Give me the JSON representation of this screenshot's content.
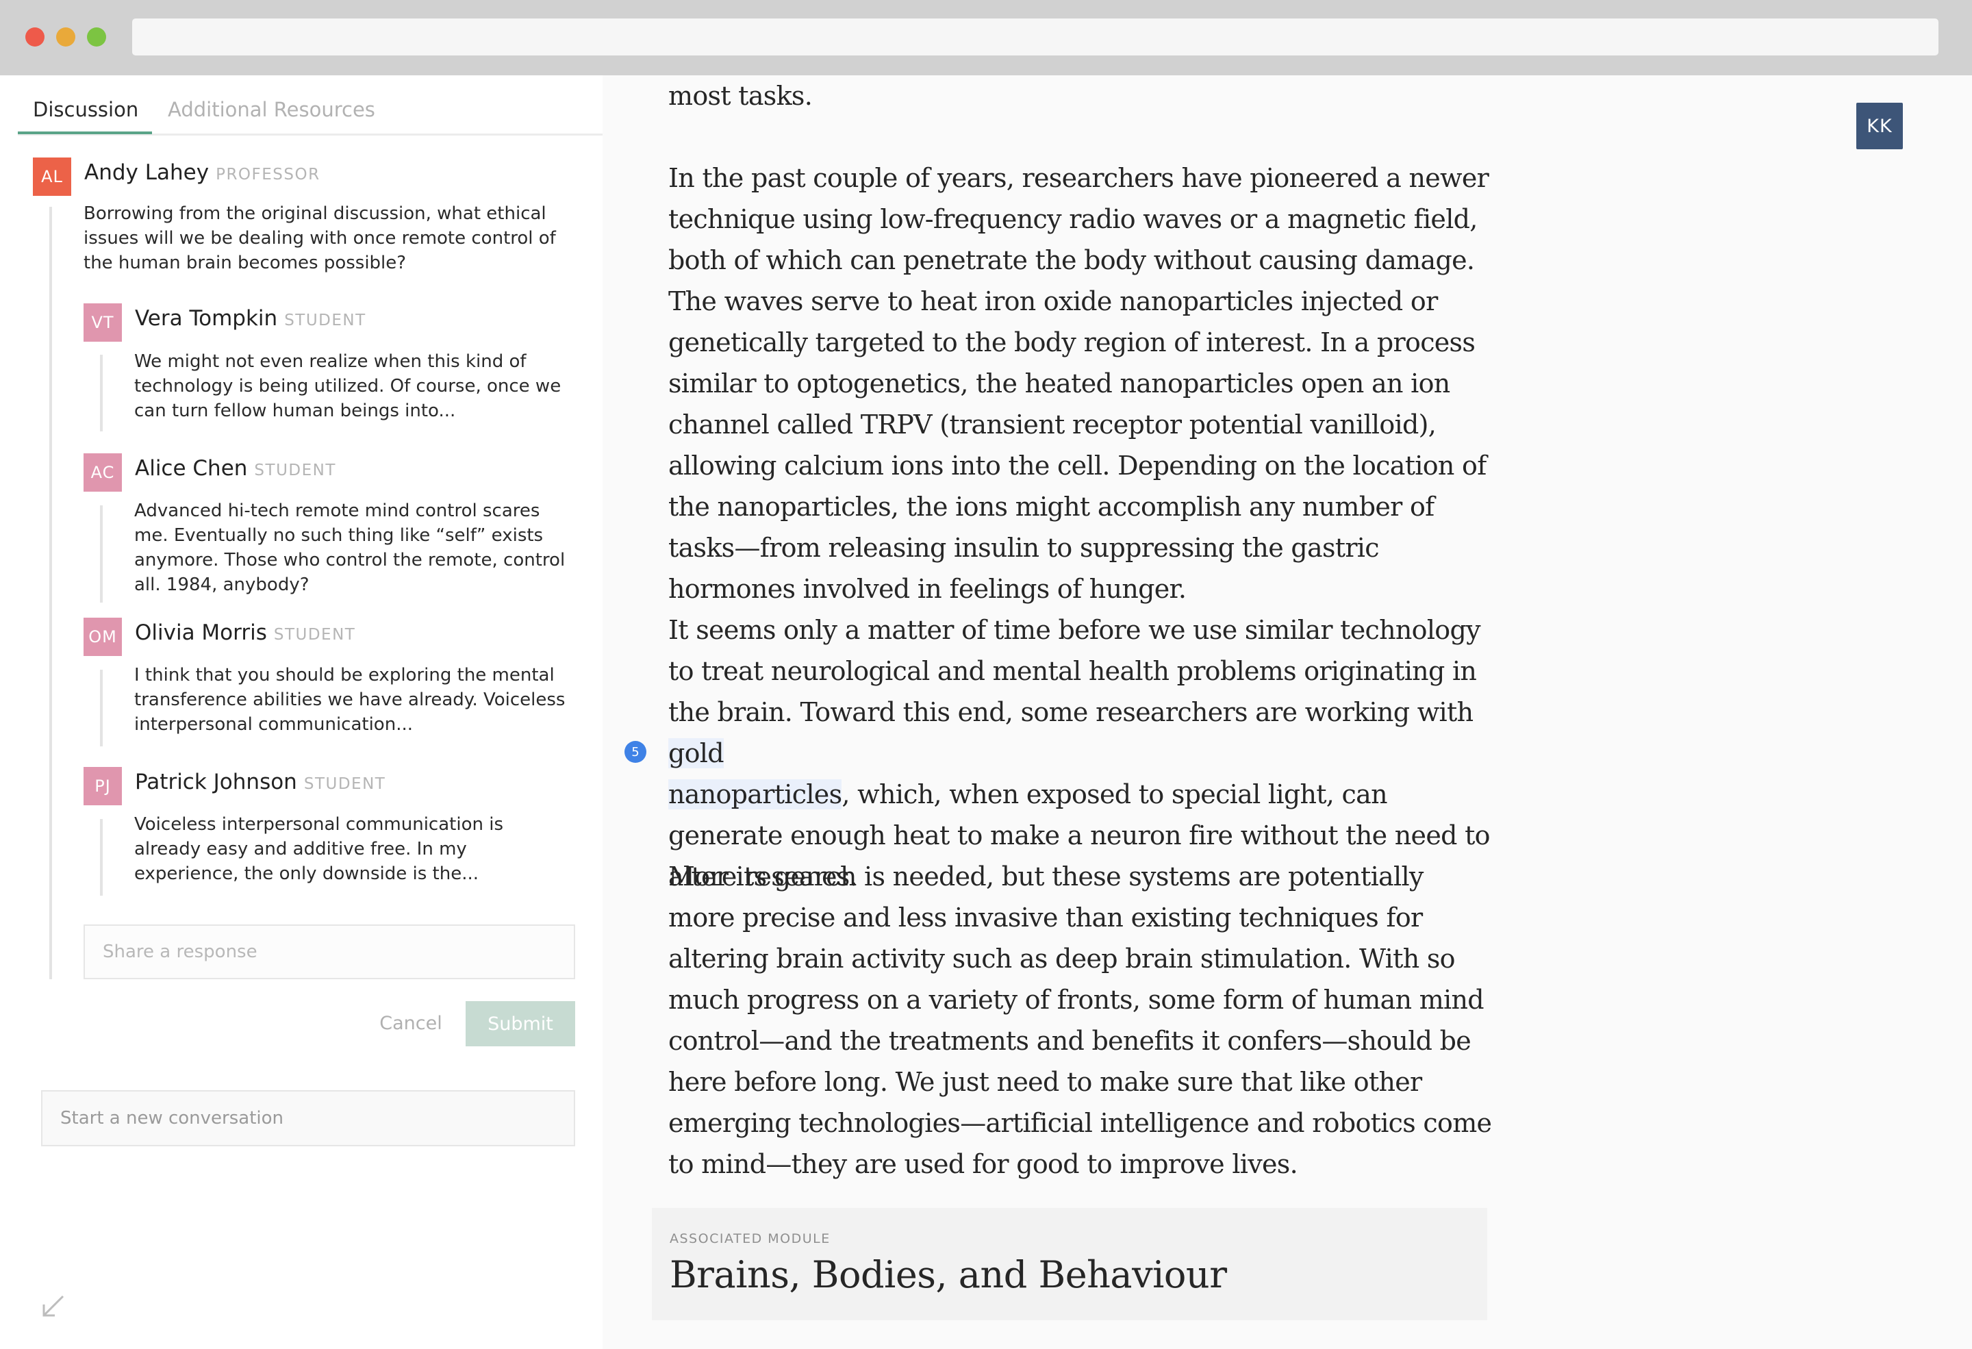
{
  "tabs": [
    {
      "label": "Discussion"
    },
    {
      "label": "Additional Resources"
    }
  ],
  "thread": {
    "root": {
      "initials": "AL",
      "name": "Andy Lahey",
      "role": "PROFESSOR",
      "text": "Borrowing from the original discussion, what ethical issues will we be dealing with once remote control of the human brain becomes possible?"
    },
    "replies": [
      {
        "initials": "VT",
        "name": "Vera Tompkin",
        "role": "STUDENT",
        "text": "We might not even realize when this kind of technology is being utilized. Of course, once we can turn fellow human beings into..."
      },
      {
        "initials": "AC",
        "name": "Alice Chen",
        "role": "STUDENT",
        "text": "Advanced hi-tech remote mind control scares me. Eventually no such thing like “self” exists anymore. Those who control the remote, control all. 1984, anybody?"
      },
      {
        "initials": "OM",
        "name": "Olivia Morris",
        "role": "STUDENT",
        "text": "I think that you should be exploring the mental transference abilities we have already. Voiceless interpersonal communication..."
      },
      {
        "initials": "PJ",
        "name": "Patrick Johnson",
        "role": "STUDENT",
        "text": "Voiceless interpersonal communication is already easy and additive free. In my experience, the only downside is the..."
      }
    ],
    "response_placeholder": "Share a response",
    "cancel_label": "Cancel",
    "submit_label": "Submit"
  },
  "new_conversation_placeholder": "Start a new conversation",
  "collapse_icon": "collapse-arrow-icon",
  "article": {
    "fragment": "most tasks.",
    "p1": "In the past couple of years, researchers have pioneered a newer technique using low-frequency radio waves or a magnetic field, both of which can penetrate the body without causing damage. The waves serve to heat iron oxide nanoparticles injected or genetically targeted to the body region of interest. In a process similar to optogenetics, the heated nanoparticles open an ion channel called TRPV (transient receptor potential vanilloid), allowing calcium ions into the cell. Depending on the location of the nanoparticles, the ions might accomplish any number of tasks—from releasing insulin to suppressing the gastric hormones involved in feelings of hunger.",
    "p2_before": "It seems only a matter of time before we use similar technology to treat neurological and mental health problems originating in the brain. Toward this end, some researchers are working with ",
    "p2_highlight_1": "gold",
    "p2_highlight_2": "nanoparticles",
    "p2_after": ", which, when exposed to special light, can generate enough heat to make a neuron fire without the need to alter its genes.",
    "p3": "More research is needed, but these systems are potentially more precise and less invasive than existing techniques for altering brain activity such as deep brain stimulation. With so much progress on a variety of fronts, some form of human mind control—and the treatments and benefits it confers—should be here before long. We just need to make sure that like other emerging technologies—artificial intelligence and robotics come to mind—they are used for good to improve lives.",
    "annotation_count": "5"
  },
  "module": {
    "label": "ASSOCIATED MODULE",
    "title": "Brains, Bodies, and Behaviour"
  },
  "user": {
    "initials": "KK"
  },
  "colors": {
    "accent_green": "#5aa488",
    "professor_avatar": "#ec6248",
    "student_avatar": "#e096ae",
    "highlight": "#eaf0fb",
    "annotation_badge": "#3f82e6",
    "user_avatar": "#3d5578"
  }
}
